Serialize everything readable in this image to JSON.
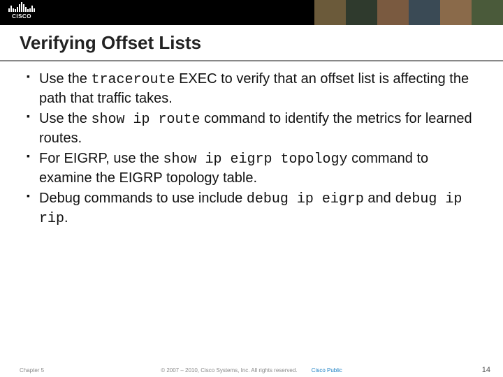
{
  "header": {
    "logo_text": "CISCO",
    "title": "Verifying Offset Lists"
  },
  "bullets": [
    {
      "pre": "Use the ",
      "code": "traceroute",
      "post": " EXEC to verify that an offset list is affecting the path that traffic takes."
    },
    {
      "pre": "Use the ",
      "code": "show ip route",
      "post": " command to identify the metrics for learned routes."
    },
    {
      "pre": "For EIGRP, use the ",
      "code": "show ip eigrp topology",
      "post": " command to examine the EIGRP topology table."
    },
    {
      "pre": "Debug commands to use include ",
      "code": "debug ip eigrp",
      "mid": " and ",
      "code2": "debug ip rip",
      "post": "."
    }
  ],
  "footer": {
    "chapter": "Chapter 5",
    "copyright": "© 2007 – 2010, Cisco Systems, Inc. All rights reserved.",
    "classification": "Cisco Public",
    "page": "14"
  }
}
